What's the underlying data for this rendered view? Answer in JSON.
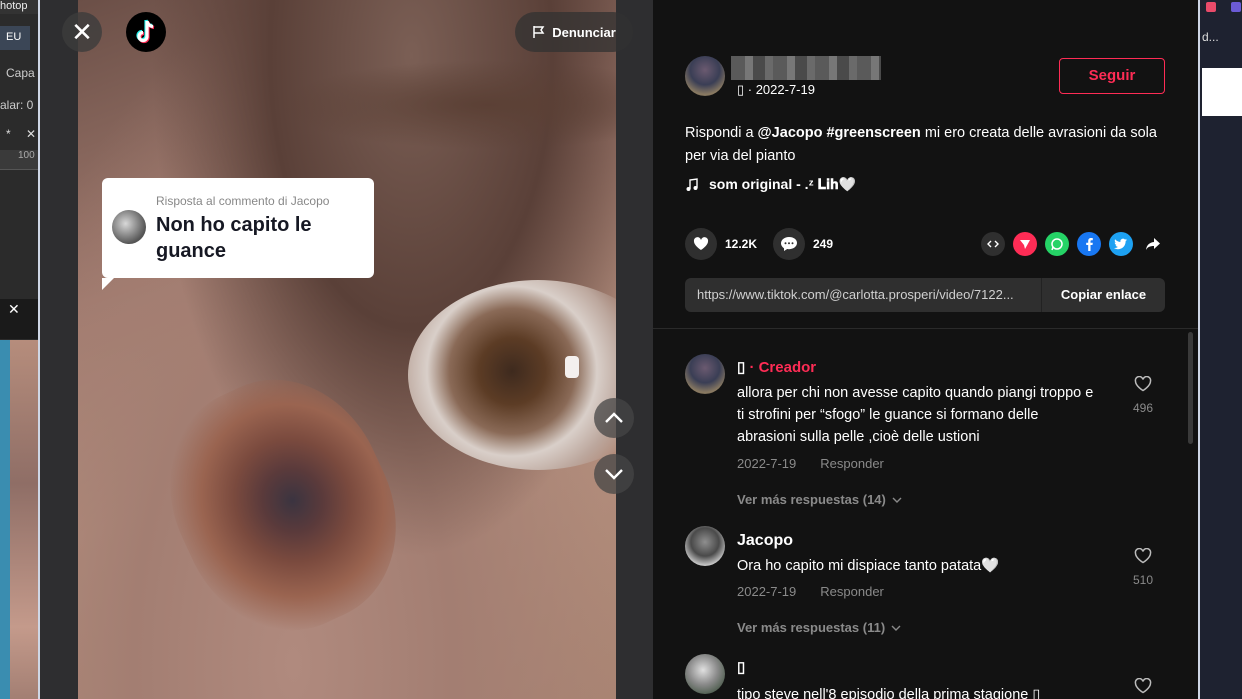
{
  "background_left": {
    "title": "hotop",
    "lang": "EU",
    "layer_label": "Capa",
    "scale_label": "alar: 0",
    "tab_star": "*",
    "tab_close": "✕",
    "ruler_value": "100",
    "close": "✕"
  },
  "background_right": {
    "text": "d..."
  },
  "video": {
    "close_label": "✕",
    "report_label": "Denunciar",
    "reply": {
      "meta": "Risposta al commento di Jacopo",
      "text": "Non ho capito le guance"
    }
  },
  "author": {
    "sub": "▯ · 2022-7-19",
    "follow_label": "Seguir"
  },
  "description": {
    "prefix": "Rispondi a",
    "mention": "@Jacopo",
    "hashtag": "#greenscreen",
    "text": "mi ero creata delle avrasioni da sola per via del pianto"
  },
  "music": {
    "label": "som original - .ᶻ 𝐋𝐢𝐡🤍"
  },
  "stats": {
    "likes": "12.2K",
    "comments": "249"
  },
  "share": {
    "url": "https://www.tiktok.com/@carlotta.prosperi/video/7122...",
    "copy_label": "Copiar enlace"
  },
  "comments": [
    {
      "name": "▯",
      "creator_label": "· Creador",
      "text": "allora per chi non avesse capito quando piangi troppo e ti strofini per “sfogo” le guance si formano delle abrasioni sulla pelle ,cioè delle ustioni",
      "date": "2022-7-19",
      "reply_label": "Responder",
      "likes": "496",
      "more": "Ver más respuestas (14)"
    },
    {
      "name": "Jacopo",
      "text": "Ora ho capito mi dispiace tanto patata🤍",
      "date": "2022-7-19",
      "reply_label": "Responder",
      "likes": "510",
      "more": "Ver más respuestas (11)"
    },
    {
      "name": "▯",
      "text": "tipo steve nell'8 episodio della prima stagione ▯"
    }
  ],
  "colors": {
    "accent": "#fe2c55",
    "background": "#121212"
  }
}
